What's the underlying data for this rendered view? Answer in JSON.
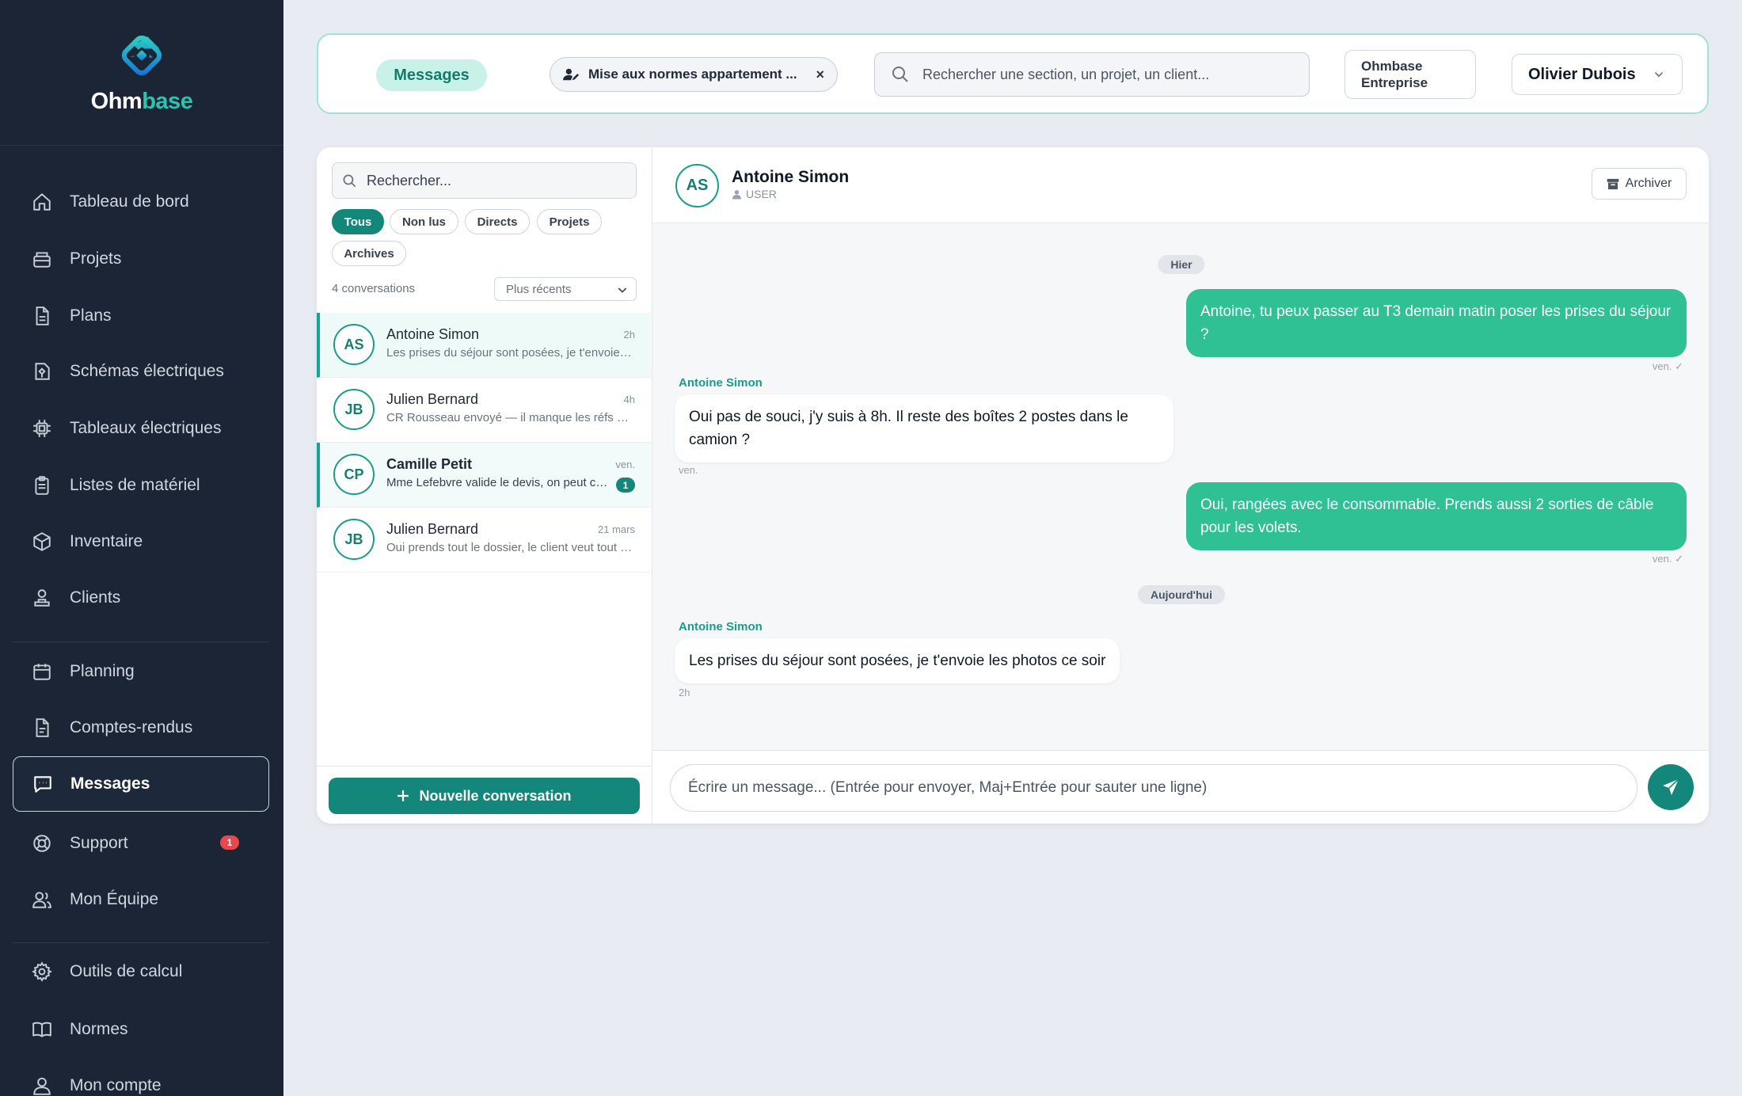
{
  "brand": {
    "name_part1": "Ohm",
    "name_part2": "base",
    "logo": "ohmbase-logo"
  },
  "sidebar": {
    "items": [
      {
        "label": "Tableau de bord",
        "icon": "home-icon"
      },
      {
        "label": "Projets",
        "icon": "folder-icon"
      },
      {
        "label": "Plans",
        "icon": "file-icon"
      },
      {
        "label": "Schémas électriques",
        "icon": "schematic-icon"
      },
      {
        "label": "Tableaux électriques",
        "icon": "chip-icon"
      },
      {
        "label": "Listes de matériel",
        "icon": "clipboard-icon"
      },
      {
        "label": "Inventaire",
        "icon": "box-icon"
      },
      {
        "label": "Clients",
        "icon": "clients-icon"
      },
      {
        "label": "Planning",
        "icon": "calendar-icon"
      },
      {
        "label": "Comptes-rendus",
        "icon": "document-icon"
      },
      {
        "label": "Messages",
        "icon": "message-icon",
        "active": true
      },
      {
        "label": "Support",
        "icon": "lifebuoy-icon",
        "badge": "1"
      },
      {
        "label": "Mon Équipe",
        "icon": "team-icon"
      },
      {
        "label": "Outils de calcul",
        "icon": "gear-icon"
      },
      {
        "label": "Normes",
        "icon": "book-icon"
      },
      {
        "label": "Mon compte",
        "icon": "user-icon"
      }
    ]
  },
  "topbar": {
    "section_pill": "Messages",
    "project_chip": "Mise aux normes appartement ...",
    "project_close": "×",
    "search_placeholder": "Rechercher une section, un projet, un client...",
    "company_line1": "Ohmbase",
    "company_line2": "Entreprise",
    "user_name": "Olivier Dubois"
  },
  "conversations": {
    "search_placeholder": "Rechercher...",
    "filters": [
      "Tous",
      "Non lus",
      "Directs",
      "Projets",
      "Archives"
    ],
    "active_filter": "Tous",
    "count_label": "4 conversations",
    "sort_label": "Plus récents",
    "items": [
      {
        "initials": "AS",
        "name": "Antoine Simon",
        "time": "2h",
        "preview": "Les prises du séjour sont posées, je t'envoie les photos ce soir",
        "selected": true
      },
      {
        "initials": "JB",
        "name": "Julien Bernard",
        "time": "4h",
        "preview": "CR Rousseau envoyé — il manque les réfs des disjoncteurs"
      },
      {
        "initials": "CP",
        "name": "Camille Petit",
        "time": "ven.",
        "preview": "Mme Lefebvre valide le devis, on peut commencer lundi",
        "unread": "1"
      },
      {
        "initials": "JB",
        "name": "Julien Bernard",
        "time": "21 mars",
        "preview": "Oui prends tout le dossier, le client veut tout revoir"
      }
    ],
    "new_button": "Nouvelle conversation"
  },
  "chat": {
    "initials": "AS",
    "name": "Antoine Simon",
    "role": "USER",
    "archive_label": "Archiver",
    "day1": "Hier",
    "day2": "Aujourd'hui",
    "messages": [
      {
        "dir": "out",
        "text": "Antoine, tu peux passer au T3 demain matin poser les prises du séjour ?",
        "meta": "ven.  ✓"
      },
      {
        "dir": "in",
        "sender": "Antoine Simon",
        "text": "Oui pas de souci, j'y suis à 8h. Il reste des boîtes 2 postes dans le camion ?",
        "meta": "ven."
      },
      {
        "dir": "out",
        "text": "Oui, rangées avec le consommable. Prends aussi 2 sorties de câble pour les volets.",
        "meta": "ven.  ✓"
      },
      {
        "dir": "in",
        "sender": "Antoine Simon",
        "text": "Les prises du séjour sont posées, je t'envoie les photos ce soir",
        "meta": "2h"
      }
    ],
    "composer_placeholder": "Écrire un message... (Entrée pour envoyer, Maj+Entrée pour sauter une ligne)"
  },
  "colors": {
    "accent": "#13877a",
    "bubble_out": "#2fc094",
    "sidebar_bg": "#1b2536",
    "brand_teal": "#2bc4b0",
    "badge_red": "#e5484d"
  }
}
